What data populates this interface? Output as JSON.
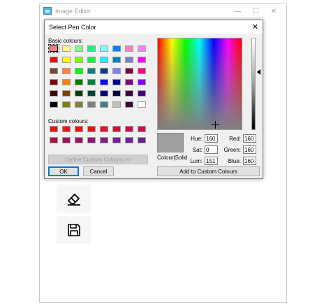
{
  "editor": {
    "title": "Image Editor",
    "minimize_glyph": "—",
    "maximize_glyph": "☐",
    "close_glyph": "✕",
    "tools": [
      {
        "icon": "eraser-icon"
      },
      {
        "icon": "save-icon"
      }
    ]
  },
  "dialog": {
    "title": "Select Pen Color",
    "close_glyph": "✕",
    "basic_label": "Basic colours:",
    "custom_label": "Custom colours:",
    "basic_colours": [
      [
        "#ff8080",
        "#ffff80",
        "#80ff80",
        "#00ff80",
        "#80ffff",
        "#0080ff",
        "#ff80c0",
        "#ff80ff"
      ],
      [
        "#ff0000",
        "#ffff00",
        "#80ff00",
        "#00ff40",
        "#00ffff",
        "#0080c0",
        "#8080c0",
        "#ff00ff"
      ],
      [
        "#804040",
        "#ff8040",
        "#00ff00",
        "#008080",
        "#004080",
        "#8080ff",
        "#800040",
        "#ff0080"
      ],
      [
        "#800000",
        "#ff8000",
        "#008000",
        "#008040",
        "#0000ff",
        "#0000a0",
        "#800080",
        "#8000ff"
      ],
      [
        "#400000",
        "#804000",
        "#004000",
        "#004040",
        "#000080",
        "#000040",
        "#400040",
        "#400080"
      ],
      [
        "#000000",
        "#808000",
        "#808040",
        "#808080",
        "#408080",
        "#c0c0c0",
        "#400040",
        "#ffffff"
      ]
    ],
    "selected_swatch": [
      0,
      0
    ],
    "custom_colours": [
      [
        "#ee1111",
        "#ee1111",
        "#ee1111",
        "#ee1111",
        "#e8102c",
        "#d0103a",
        "#c8104a",
        "#c81050"
      ],
      [
        "#b01048",
        "#a0105a",
        "#9a1468",
        "#8c1878",
        "#80208c",
        "#781c98",
        "#7020a0",
        "#682090"
      ]
    ],
    "define_button": "Define Custom Colours >>",
    "ok_button": "OK",
    "cancel_button": "Cancel",
    "add_button": "Add to Custom Colours",
    "preview_label": "Colour|Solid",
    "preview_color": "#a0a0a0",
    "fields": {
      "hue": {
        "label": "Hue:",
        "value": "160"
      },
      "sat": {
        "label": "Sat:",
        "value": "0"
      },
      "lum": {
        "label": "Lum:",
        "value": "151"
      },
      "red": {
        "label": "Red:",
        "value": "160"
      },
      "green": {
        "label": "Green:",
        "value": "160"
      },
      "blue": {
        "label": "Blue:",
        "value": "160"
      }
    }
  }
}
